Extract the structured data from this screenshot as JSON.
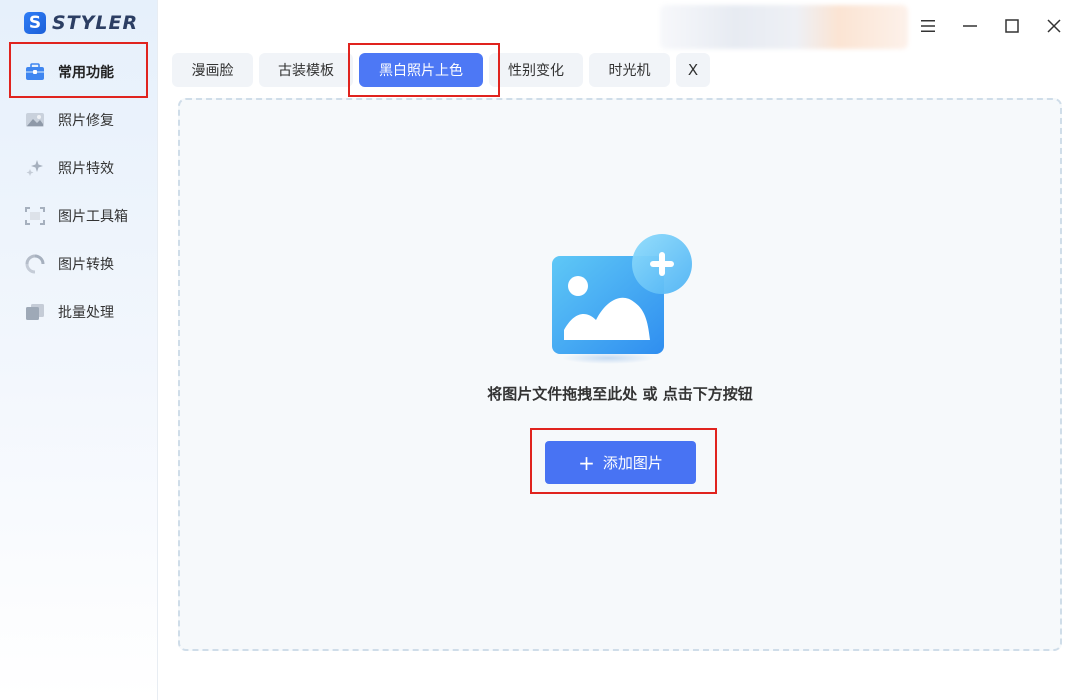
{
  "app": {
    "logo_letter": "S",
    "brand": "STYLER"
  },
  "sidebar": {
    "items": [
      {
        "label": "常用功能",
        "icon": "toolbox-icon",
        "active": true
      },
      {
        "label": "照片修复",
        "icon": "photo-icon",
        "active": false
      },
      {
        "label": "照片特效",
        "icon": "sparkle-icon",
        "active": false
      },
      {
        "label": "图片工具箱",
        "icon": "crop-frame-icon",
        "active": false
      },
      {
        "label": "图片转换",
        "icon": "convert-icon",
        "active": false
      },
      {
        "label": "批量处理",
        "icon": "stack-icon",
        "active": false
      }
    ]
  },
  "tabs": {
    "items": [
      {
        "label": "漫画脸",
        "active": false
      },
      {
        "label": "古装模板",
        "active": false
      },
      {
        "label": "黑白照片上色",
        "active": true
      },
      {
        "label": "性别变化",
        "active": false
      },
      {
        "label": "时光机",
        "active": false
      }
    ],
    "close_label": "X"
  },
  "dropzone": {
    "hint": "将图片文件拖拽至此处 或 点击下方按钮",
    "button_icon": "+",
    "button_label": "添加图片"
  },
  "colors": {
    "accent": "#4873f3",
    "tab_active": "#4d78f5",
    "highlight": "#e0231e"
  }
}
